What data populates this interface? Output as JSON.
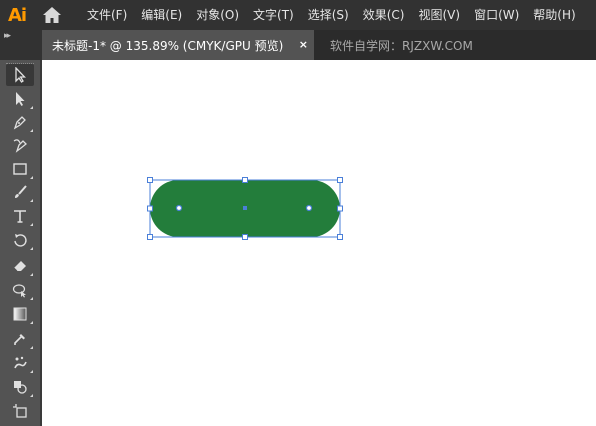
{
  "app": {
    "logo": "Ai"
  },
  "menu": {
    "items": [
      {
        "label": "文件(F)"
      },
      {
        "label": "编辑(E)"
      },
      {
        "label": "对象(O)"
      },
      {
        "label": "文字(T)"
      },
      {
        "label": "选择(S)"
      },
      {
        "label": "效果(C)"
      },
      {
        "label": "视图(V)"
      },
      {
        "label": "窗口(W)"
      },
      {
        "label": "帮助(H)"
      }
    ]
  },
  "tabs": {
    "active": {
      "title": "未标题-1* @ 135.89% (CMYK/GPU 预览)",
      "close": "×"
    },
    "other": {
      "title": "软件自学网：RJZXW.COM"
    }
  },
  "colors": {
    "menubar": "#323232",
    "tab_active": "#535353",
    "toolbar": "#535353",
    "shape_fill": "#237d3b",
    "selection": "#4a7fd8",
    "logo": "#ff9a00"
  },
  "tools": [
    {
      "icon": "selection-arrow-icon",
      "active": true
    },
    {
      "icon": "direct-selection-icon",
      "active": false
    },
    {
      "icon": "pen-icon",
      "active": false
    },
    {
      "icon": "curvature-pen-icon",
      "active": false
    },
    {
      "icon": "rectangle-icon",
      "active": false
    },
    {
      "icon": "paintbrush-icon",
      "active": false
    },
    {
      "icon": "type-icon",
      "active": false
    },
    {
      "icon": "rotate-icon",
      "active": false
    },
    {
      "icon": "eraser-icon",
      "active": false
    },
    {
      "icon": "puppet-warp-icon",
      "active": false
    },
    {
      "icon": "gradient-icon",
      "active": false
    },
    {
      "icon": "eyedropper-icon",
      "active": false
    },
    {
      "icon": "symbol-sprayer-icon",
      "active": false
    },
    {
      "icon": "shape-builder-icon",
      "active": false
    },
    {
      "icon": "artboard-icon",
      "active": false
    }
  ],
  "canvas": {
    "object": {
      "shape": "rounded-rectangle",
      "selected": true
    }
  }
}
